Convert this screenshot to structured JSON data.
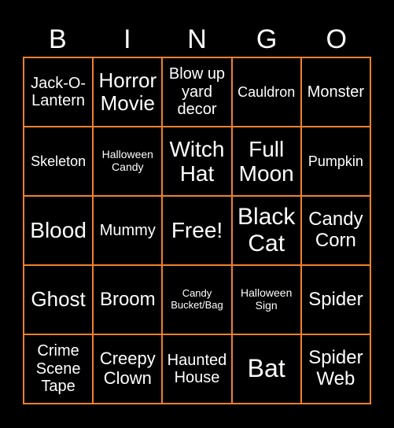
{
  "header": [
    "B",
    "I",
    "N",
    "G",
    "O"
  ],
  "border_color": "#f0812b",
  "cells": [
    [
      "Jack-O-Lantern",
      "Horror Movie",
      "Blow up yard decor",
      "Cauldron",
      "Monster"
    ],
    [
      "Skeleton",
      "Halloween Candy",
      "Witch Hat",
      "Full Moon",
      "Pumpkin"
    ],
    [
      "Blood",
      "Mummy",
      "Free!",
      "Black Cat",
      "Candy Corn"
    ],
    [
      "Ghost",
      "Broom",
      "Candy Bucket/Bag",
      "Halloween Sign",
      "Spider"
    ],
    [
      "Crime Scene Tape",
      "Creepy Clown",
      "Haunted House",
      "Bat",
      "Spider Web"
    ]
  ]
}
